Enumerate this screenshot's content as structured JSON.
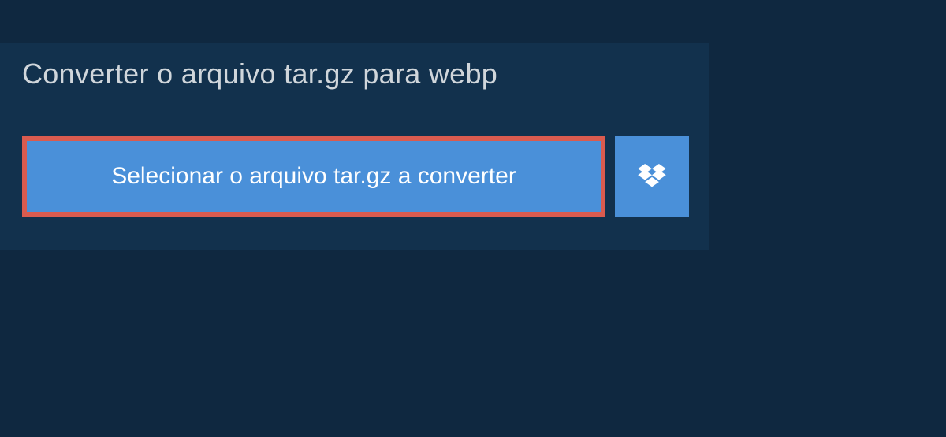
{
  "header": {
    "title": "Converter o arquivo tar.gz para webp"
  },
  "actions": {
    "select_file_label": "Selecionar o arquivo tar.gz a converter"
  },
  "colors": {
    "background": "#0f2840",
    "panel": "#12314d",
    "button": "#4a90d9",
    "highlight_border": "#da5b4f"
  }
}
